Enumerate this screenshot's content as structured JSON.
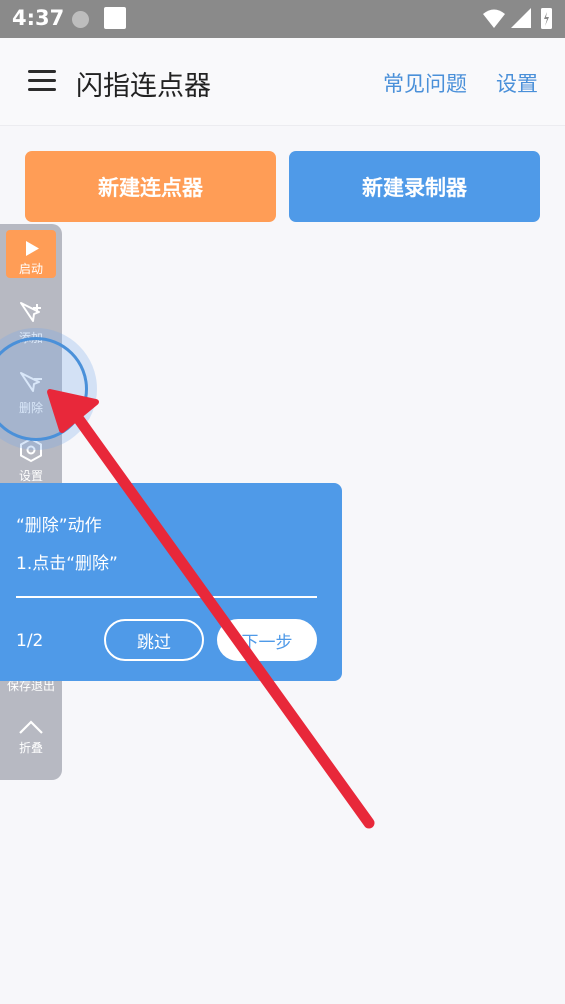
{
  "status_bar": {
    "time": "4:37"
  },
  "app_bar": {
    "title": "闪指连点器",
    "faq_label": "常见问题",
    "settings_label": "设置"
  },
  "actions": {
    "new_clicker": "新建连点器",
    "new_recorder": "新建录制器"
  },
  "float_bar": {
    "items": [
      {
        "label": "启动",
        "icon": "play-icon"
      },
      {
        "label": "添加",
        "icon": "cursor-plus-icon"
      },
      {
        "label": "删除",
        "icon": "cursor-minus-icon"
      },
      {
        "label": "设置",
        "icon": "hexagon-gear-icon"
      },
      {
        "label": "保存退出",
        "icon": "save-exit-icon"
      },
      {
        "label": "折叠",
        "icon": "chevron-up-icon"
      }
    ]
  },
  "tooltip": {
    "title": "“删除”动作",
    "step": "1.点击“删除”",
    "page": "1/2",
    "skip_label": "跳过",
    "next_label": "下一步"
  },
  "colors": {
    "orange": "#ff9d56",
    "blue": "#4f9ae8",
    "arrow": "#e8283a",
    "float_bar": "#b7b9c2"
  }
}
